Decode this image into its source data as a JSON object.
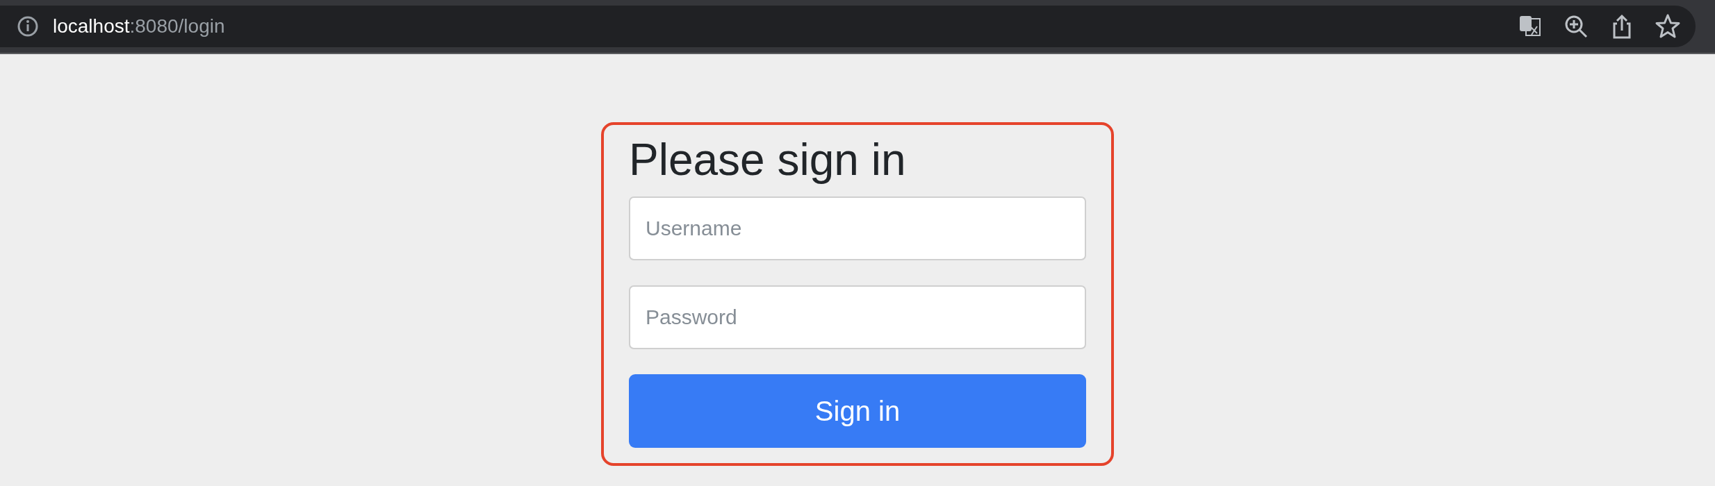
{
  "address_bar": {
    "host": "localhost",
    "path": ":8080/login"
  },
  "form": {
    "heading": "Please sign in",
    "fields": [
      {
        "placeholder": "Username"
      },
      {
        "placeholder": "Password"
      }
    ],
    "button": "Sign in"
  }
}
